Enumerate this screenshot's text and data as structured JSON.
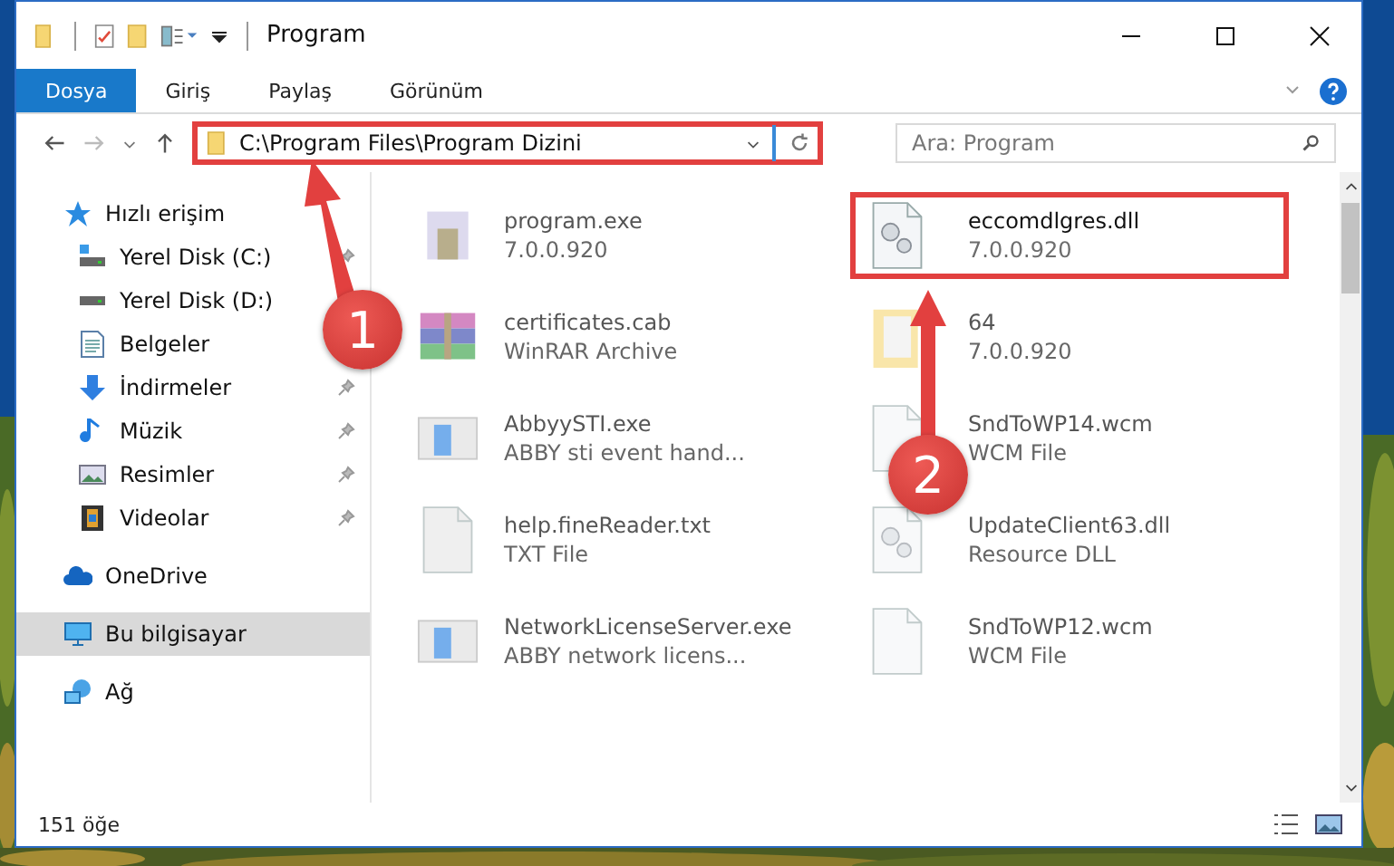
{
  "window": {
    "title": "Program"
  },
  "ribbon": {
    "tabs": [
      {
        "label": "Dosya",
        "selected": true
      },
      {
        "label": "Giriş",
        "selected": false
      },
      {
        "label": "Paylaş",
        "selected": false
      },
      {
        "label": "Görünüm",
        "selected": false
      }
    ]
  },
  "address_bar": {
    "path": "C:\\Program Files\\Program Dizini",
    "highlighted": true
  },
  "search": {
    "placeholder": "Ara: Program"
  },
  "sidebar": {
    "items": [
      {
        "label": "Hızlı erişim",
        "kind": "star",
        "selected": false,
        "children": [
          {
            "label": "Yerel Disk (C:)",
            "kind": "drive-c",
            "pinned": true
          },
          {
            "label": "Yerel Disk (D:)",
            "kind": "drive"
          },
          {
            "label": "Belgeler",
            "kind": "docs"
          },
          {
            "label": "İndirmeler",
            "kind": "download",
            "pinned": true
          },
          {
            "label": "Müzik",
            "kind": "music",
            "pinned": true
          },
          {
            "label": "Resimler",
            "kind": "pictures",
            "pinned": true
          },
          {
            "label": "Videolar",
            "kind": "videos",
            "pinned": true
          }
        ]
      },
      {
        "label": "OneDrive",
        "kind": "cloud",
        "selected": false
      },
      {
        "label": "Bu bilgisayar",
        "kind": "pc",
        "selected": true
      },
      {
        "label": "Ağ",
        "kind": "network",
        "selected": false
      }
    ]
  },
  "files": [
    {
      "name": "program.exe",
      "detail": "7.0.0.920",
      "kind": "setup",
      "blurred": true,
      "highlighted": false
    },
    {
      "name": "eccomdlgres.dll",
      "detail": "7.0.0.920",
      "kind": "dll",
      "blurred": false,
      "highlighted": true
    },
    {
      "name": "certificates.cab",
      "detail": "WinRAR Archive",
      "kind": "archive",
      "blurred": true,
      "highlighted": false
    },
    {
      "name": "64",
      "detail": "7.0.0.920",
      "kind": "folder",
      "blurred": true,
      "highlighted": false
    },
    {
      "name": "AbbyySTI.exe",
      "detail": "ABBY sti event hand...",
      "kind": "app",
      "blurred": true,
      "highlighted": false
    },
    {
      "name": "SndToWP14.wcm",
      "detail": "WCM File",
      "kind": "blank",
      "blurred": true,
      "highlighted": false
    },
    {
      "name": "help.fineReader.txt",
      "detail": "TXT File",
      "kind": "text",
      "blurred": true,
      "highlighted": false
    },
    {
      "name": "UpdateClient63.dll",
      "detail": "Resource DLL",
      "kind": "dll",
      "blurred": true,
      "highlighted": false
    },
    {
      "name": "NetworkLicenseServer.exe",
      "detail": "ABBY network licens...",
      "kind": "app",
      "blurred": true,
      "highlighted": false
    },
    {
      "name": "SndToWP12.wcm",
      "detail": "WCM File",
      "kind": "blank",
      "blurred": true,
      "highlighted": false
    }
  ],
  "annotations": [
    {
      "label": "1"
    },
    {
      "label": "2"
    }
  ],
  "status_bar": {
    "item_count": "151 öğe"
  }
}
